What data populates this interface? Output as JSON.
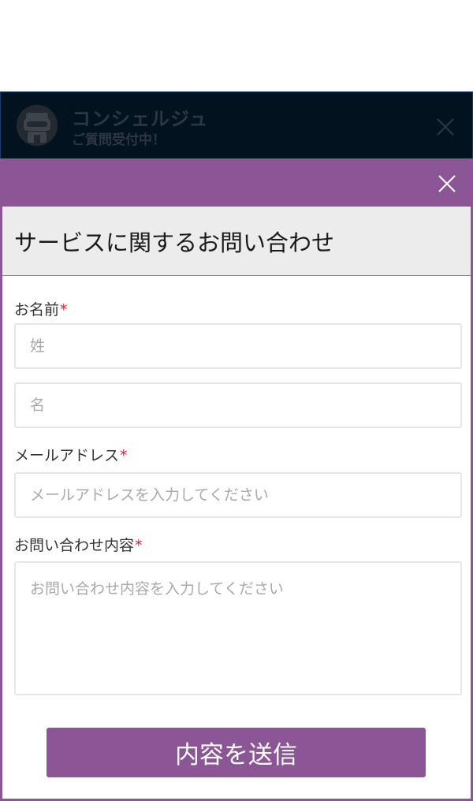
{
  "chat_header": {
    "title": "コンシェルジュ",
    "status": "ご質問受付中！"
  },
  "form": {
    "heading": "サービスに関するお問い合わせ",
    "required_mark": "*",
    "name": {
      "label": "お名前",
      "last_name_placeholder": "姓",
      "first_name_placeholder": "名"
    },
    "email": {
      "label": "メールアドレス",
      "placeholder": "メールアドレスを入力してください"
    },
    "message": {
      "label": "お問い合わせ内容",
      "placeholder": "お問い合わせ内容を入力してください"
    },
    "submit_label": "内容を送信"
  },
  "colors": {
    "accent": "#8c5595",
    "header_bg": "#03121f",
    "required": "#e0202a"
  },
  "icons": {
    "chat_close": "close-icon",
    "modal_close": "close-icon",
    "avatar": "robot-avatar-icon"
  }
}
